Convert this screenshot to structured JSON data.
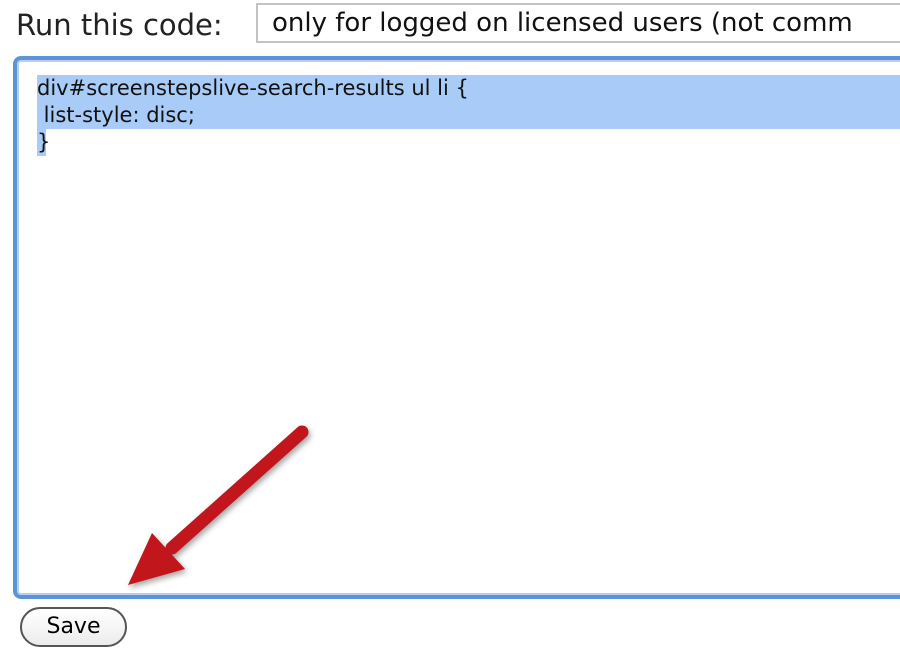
{
  "form": {
    "run_label": "Run this code:",
    "run_option_selected": "only for logged on licensed users (not comm",
    "code_lines": [
      "div#screenstepslive-search-results ul li {",
      " list-style: disc;",
      "}"
    ],
    "save_label": "Save"
  },
  "annotation": {
    "arrow_color": "#c0151a",
    "arrow_icon": "red-arrow-icon"
  },
  "colors": {
    "focus_border": "#5e93d4",
    "selection": "#a8cbf7"
  }
}
